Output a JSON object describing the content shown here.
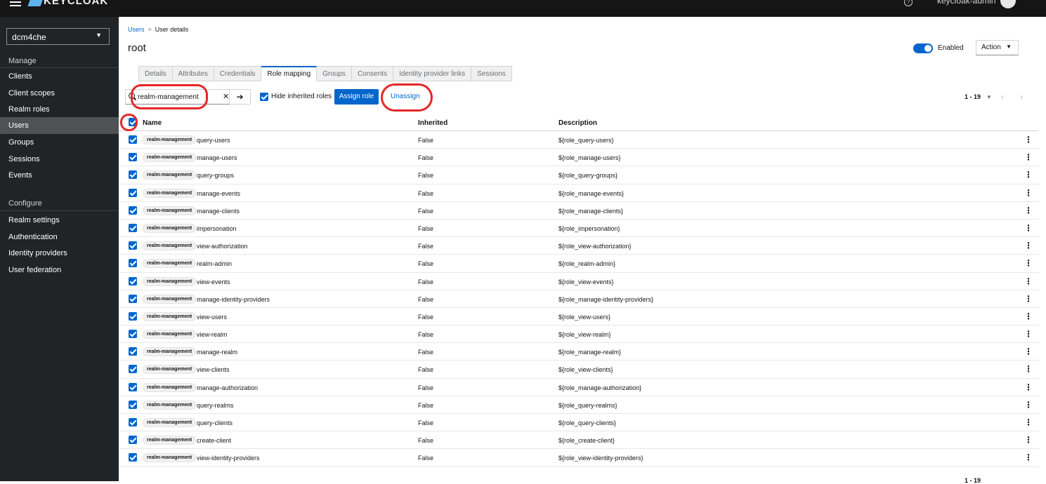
{
  "header": {
    "brand": "KEYCLOAK",
    "user": "keycloak-admin"
  },
  "sidebar": {
    "realm": "dcm4che",
    "manage_label": "Manage",
    "manage_items": [
      "Clients",
      "Client scopes",
      "Realm roles",
      "Users",
      "Groups",
      "Sessions",
      "Events"
    ],
    "active_item": "Users",
    "configure_label": "Configure",
    "configure_items": [
      "Realm settings",
      "Authentication",
      "Identity providers",
      "User federation"
    ]
  },
  "breadcrumb": {
    "parent": "Users",
    "current": "User details"
  },
  "page": {
    "title": "root",
    "enabled_label": "Enabled",
    "action_label": "Action"
  },
  "tabs": [
    "Details",
    "Attributes",
    "Credentials",
    "Role mapping",
    "Groups",
    "Consents",
    "Identity provider links",
    "Sessions"
  ],
  "active_tab": "Role mapping",
  "toolbar": {
    "search_value": "realm-management",
    "hide_inherited_label": "Hide inherited roles",
    "assign_label": "Assign role",
    "unassign_label": "Unassign",
    "pagination": "1 - 19"
  },
  "table": {
    "columns": [
      "Name",
      "Inherited",
      "Description"
    ],
    "client_badge": "realm-management",
    "rows": [
      {
        "name": "query-users",
        "inherited": "False",
        "description": "${role_query-users}"
      },
      {
        "name": "manage-users",
        "inherited": "False",
        "description": "${role_manage-users}"
      },
      {
        "name": "query-groups",
        "inherited": "False",
        "description": "${role_query-groups}"
      },
      {
        "name": "manage-events",
        "inherited": "False",
        "description": "${role_manage-events}"
      },
      {
        "name": "manage-clients",
        "inherited": "False",
        "description": "${role_manage-clients}"
      },
      {
        "name": "impersonation",
        "inherited": "False",
        "description": "${role_impersonation}"
      },
      {
        "name": "view-authorization",
        "inherited": "False",
        "description": "${role_view-authorization}"
      },
      {
        "name": "realm-admin",
        "inherited": "False",
        "description": "${role_realm-admin}"
      },
      {
        "name": "view-events",
        "inherited": "False",
        "description": "${role_view-events}"
      },
      {
        "name": "manage-identity-providers",
        "inherited": "False",
        "description": "${role_manage-identity-providers}"
      },
      {
        "name": "view-users",
        "inherited": "False",
        "description": "${role_view-users}"
      },
      {
        "name": "view-realm",
        "inherited": "False",
        "description": "${role_view-realm}"
      },
      {
        "name": "manage-realm",
        "inherited": "False",
        "description": "${role_manage-realm}"
      },
      {
        "name": "view-clients",
        "inherited": "False",
        "description": "${role_view-clients}"
      },
      {
        "name": "manage-authorization",
        "inherited": "False",
        "description": "${role_manage-authorization}"
      },
      {
        "name": "query-realms",
        "inherited": "False",
        "description": "${role_query-realms}"
      },
      {
        "name": "query-clients",
        "inherited": "False",
        "description": "${role_query-clients}"
      },
      {
        "name": "create-client",
        "inherited": "False",
        "description": "${role_create-client}"
      },
      {
        "name": "view-identity-providers",
        "inherited": "False",
        "description": "${role_view-identity-providers}"
      }
    ]
  },
  "footer": {
    "pagination": "1 - 19"
  },
  "colors": {
    "accent": "#0066cc",
    "sidebar_bg": "#212427",
    "topbar_bg": "#151515",
    "highlight": "#e52727"
  }
}
